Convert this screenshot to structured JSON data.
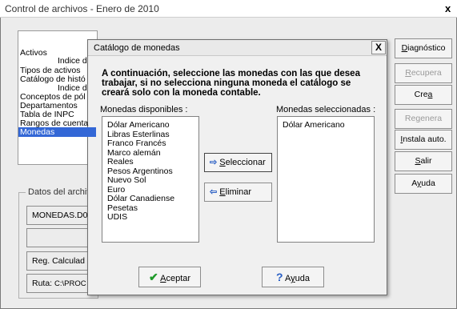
{
  "window": {
    "title": "Control de archivos - Enero de 2010",
    "close": "x"
  },
  "left_list": [
    {
      "label": "Activos",
      "indent": false,
      "selected": false
    },
    {
      "label": "Indice d",
      "indent": true,
      "selected": false
    },
    {
      "label": "Tipos de activos",
      "indent": false,
      "selected": false
    },
    {
      "label": "Catálogo de histó",
      "indent": false,
      "selected": false
    },
    {
      "label": "Indice d",
      "indent": true,
      "selected": false
    },
    {
      "label": "Conceptos de pól",
      "indent": false,
      "selected": false
    },
    {
      "label": "Departamentos",
      "indent": false,
      "selected": false
    },
    {
      "label": "Tabla de INPC",
      "indent": false,
      "selected": false
    },
    {
      "label": "Rangos de cuenta",
      "indent": false,
      "selected": false
    },
    {
      "label": "Monedas",
      "indent": false,
      "selected": true
    }
  ],
  "datos": {
    "legend": "Datos del archiv",
    "file": "MONEDAS.D0",
    "empty": "",
    "reg": "Reg. Calculad",
    "ruta_label": "Ruta:",
    "ruta_value": "C:\\PROC"
  },
  "right_buttons": [
    {
      "pre": "",
      "u": "D",
      "post": "iagnóstico",
      "disabled": false
    },
    {
      "pre": "",
      "u": "R",
      "post": "ecupera",
      "disabled": true
    },
    {
      "pre": "Cre",
      "u": "a",
      "post": "",
      "disabled": false
    },
    {
      "pre": "Re",
      "u": "g",
      "post": "enera",
      "disabled": true
    },
    {
      "pre": "",
      "u": "I",
      "post": "nstala auto.",
      "disabled": false
    },
    {
      "pre": "",
      "u": "S",
      "post": "alir",
      "disabled": false
    },
    {
      "pre": "A",
      "u": "y",
      "post": "uda",
      "disabled": false
    }
  ],
  "dialog": {
    "title": "Catálogo de monedas",
    "close": "X",
    "instruction": "A continuación, seleccione las monedas con las que desea trabajar, si no selecciona ninguna moneda el catálogo se creará solo con la moneda contable.",
    "available_label": "Monedas disponibles :",
    "selected_label": "Monedas seleccionadas :",
    "available": [
      "Dólar Americano",
      "Libras Esterlinas",
      "Franco Francés",
      "Marco alemán",
      "Reales",
      "Pesos Argentinos",
      "Nuevo Sol",
      "Euro",
      "Dólar Canadiense",
      "Pesetas",
      "UDIS"
    ],
    "selected": [
      "Dólar Americano"
    ],
    "btn_select": {
      "u": "S",
      "post": "eleccionar"
    },
    "btn_remove": {
      "u": "E",
      "post": "liminar"
    },
    "btn_accept": {
      "u": "A",
      "post": "ceptar"
    },
    "btn_help": {
      "pre": "A",
      "u": "y",
      "post": "uda"
    }
  }
}
